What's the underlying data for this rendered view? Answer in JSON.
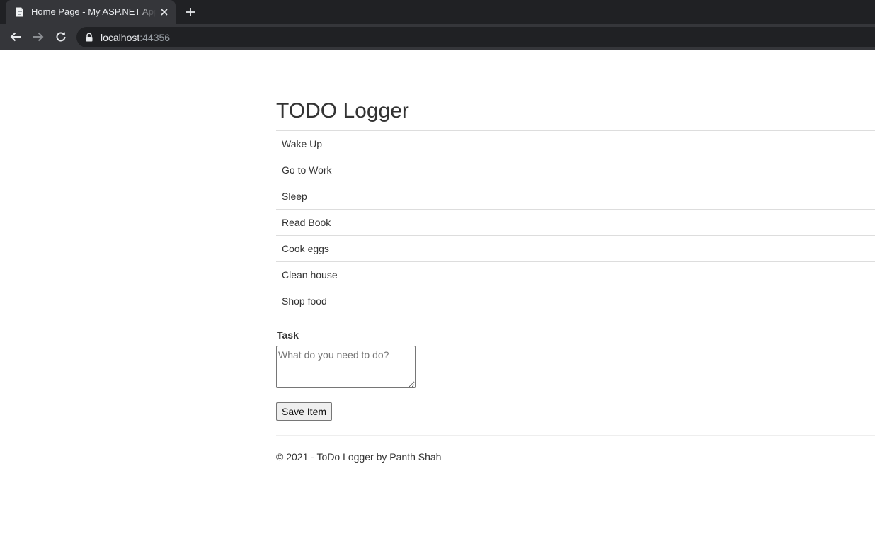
{
  "browser": {
    "tab_title": "Home Page - My ASP.NET Application",
    "url_host": "localhost",
    "url_port": ":44356",
    "chrome_colors": {
      "tabstrip": "#202124",
      "active_tab": "#35363a",
      "omnibox": "#202124"
    },
    "icons": {
      "favicon": "page-icon",
      "close": "close-icon",
      "new_tab": "plus-icon",
      "back": "arrow-left-icon",
      "forward": "arrow-right-icon",
      "reload": "reload-icon",
      "secure": "lock-icon"
    }
  },
  "page": {
    "title": "TODO Logger",
    "todos": [
      "Wake Up",
      "Go to Work",
      "Sleep",
      "Read Book",
      "Cook eggs",
      "Clean house",
      "Shop food"
    ],
    "form": {
      "task_label": "Task",
      "task_placeholder": "What do you need to do?",
      "task_value": "",
      "save_label": "Save Item"
    },
    "footer": "© 2021 - ToDo Logger by Panth Shah"
  }
}
